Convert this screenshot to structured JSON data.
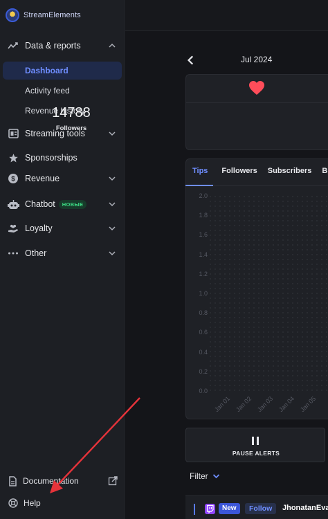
{
  "brand": {
    "name_part1": "Stream",
    "name_part2": "Elements"
  },
  "sidebar": {
    "data_reports": "Data & reports",
    "dashboard": "Dashboard",
    "activity_feed": "Activity feed",
    "revenue_history": "Revenue history",
    "streaming_tools": "Streaming tools",
    "sponsorships": "Sponsorships",
    "revenue": "Revenue",
    "chatbot": "Chatbot",
    "chatbot_badge": "НОВЫЕ",
    "loyalty": "Loyalty",
    "other": "Other",
    "documentation": "Documentation",
    "help": "Help"
  },
  "main": {
    "month": "Jul 2024",
    "followers_count": "14788",
    "followers_label": "Followers",
    "tabs": [
      "Tips",
      "Followers",
      "Subscribers",
      "Bi"
    ],
    "pause_label": "PAUSE ALERTS",
    "filter_label": "Filter",
    "feed": {
      "badge_new": "New",
      "type": "Follow",
      "user": "JhonatanEva"
    }
  },
  "chart_data": {
    "type": "bar",
    "title": "",
    "categories": [
      "Jan 01",
      "Jan 02",
      "Jan 03",
      "Jan 04",
      "Jan 05"
    ],
    "values": [
      0,
      0,
      0,
      0,
      0
    ],
    "y_ticks": [
      "2.0",
      "1.8",
      "1.6",
      "1.4",
      "1.2",
      "1.0",
      "0.8",
      "0.6",
      "0.4",
      "0.2",
      "0.0"
    ],
    "ylim": [
      0,
      2
    ],
    "grid": "dotted"
  },
  "colors": {
    "accent": "#6f8eff",
    "heart": "#ff4d5a",
    "twitch": "#9146ff",
    "annotation_arrow": "#e5333a"
  }
}
